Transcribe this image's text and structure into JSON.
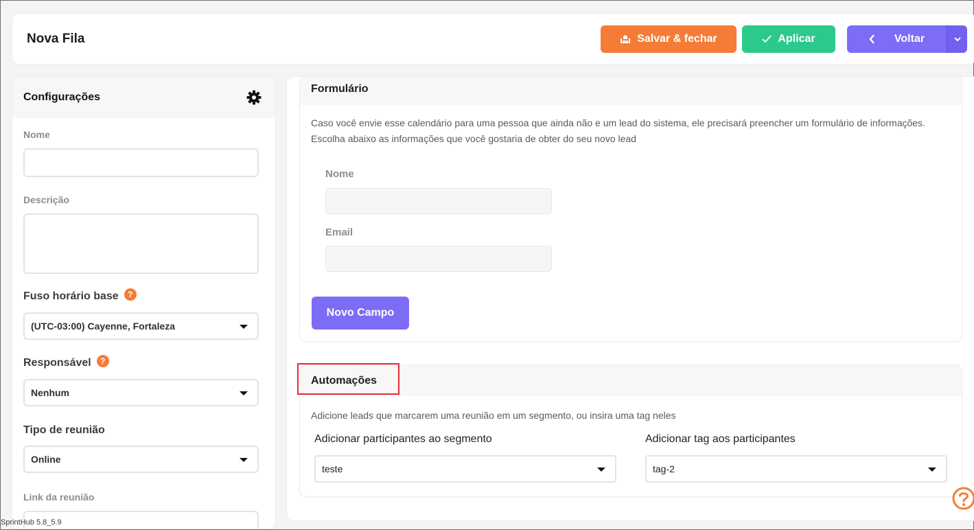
{
  "header": {
    "title": "Nova Fila",
    "save_label": "Salvar & fechar",
    "apply_label": "Aplicar",
    "back_label": "Voltar"
  },
  "config": {
    "title": "Configurações",
    "name_label": "Nome",
    "name_value": "",
    "description_label": "Descrição",
    "description_value": "",
    "timezone_label": "Fuso horário base",
    "timezone_value": "(UTC-03:00) Cayenne, Fortaleza",
    "responsible_label": "Responsável",
    "responsible_value": "Nenhum",
    "meeting_type_label": "Tipo de reunião",
    "meeting_type_value": "Online",
    "meeting_link_label": "Link da reunião",
    "help_glyph": "?"
  },
  "form": {
    "title": "Formulário",
    "description_line1": "Caso você envie esse calendário para uma pessoa que ainda não e um lead do sistema, ele precisará preencher um formulário de informações.",
    "description_line2": "Escolha abaixo as informações que você gostaria de obter do seu novo lead",
    "name_label": "Nome",
    "email_label": "Email",
    "new_field_label": "Novo Campo"
  },
  "automations": {
    "title": "Automações",
    "description": "Adicione leads que marcarem uma reunião em um segmento, ou insira uma tag neles",
    "segment_label": "Adicionar participantes ao segmento",
    "segment_value": "teste",
    "tag_label": "Adicionar tag aos participantes",
    "tag_value": "tag-2"
  },
  "footer": {
    "version": "SprintHub 5.8_5.9"
  },
  "colors": {
    "orange": "#f57c36",
    "green": "#2cc98d",
    "purple": "#7d6cf6",
    "highlight_red": "#e52b3a"
  },
  "icons": {
    "save": "save-close-icon",
    "apply": "check-icon",
    "back": "chevron-left-icon",
    "dropdown": "chevron-down-icon",
    "settings": "gear-icon",
    "help": "help-circle-icon"
  }
}
